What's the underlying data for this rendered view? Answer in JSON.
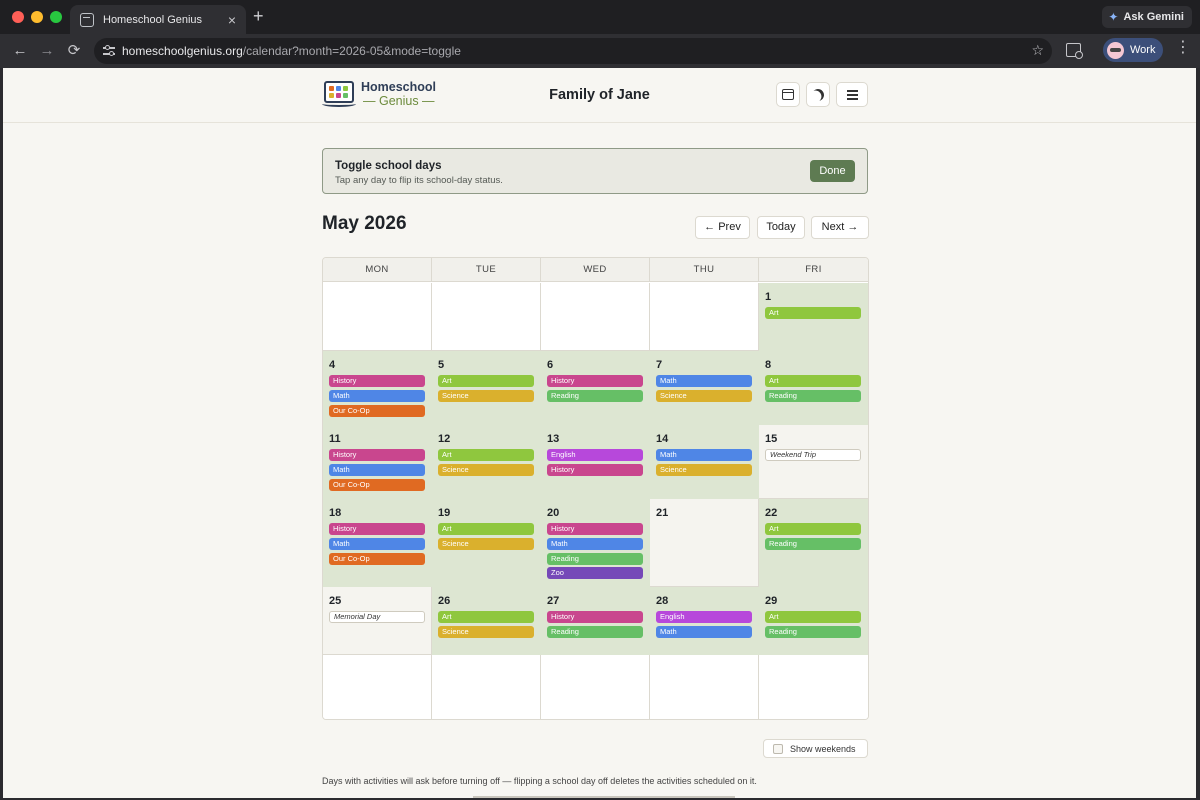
{
  "browser": {
    "tab_title": "Homeschool Genius",
    "tab_close": "×",
    "new_tab": "+",
    "gemini_label": "Ask Gemini",
    "url_host": "homeschoolgenius.org",
    "url_path": "/calendar?month=2026-05&mode=toggle",
    "profile_label": "Work",
    "back": "←",
    "forward": "→",
    "reload": "⟳",
    "star": "☆",
    "kebab": "⋮",
    "gemini_icon": "✦"
  },
  "header": {
    "logo_line1": "Homeschool",
    "logo_line2": "— Genius —",
    "family_title": "Family of Jane"
  },
  "banner": {
    "title": "Toggle school days",
    "subtitle": "Tap any day to flip its school-day status.",
    "done_label": "Done"
  },
  "calendar": {
    "month_title": "May 2026",
    "prev_label": "← Prev",
    "today_label": "Today",
    "next_label": "Next →",
    "weekdays": [
      "MON",
      "TUE",
      "WED",
      "THU",
      "FRI"
    ],
    "colors": {
      "History": "#c9468e",
      "Math": "#4f86e6",
      "Art": "#8fc73e",
      "Science": "#dab02d",
      "Reading": "#66bf66",
      "English": "#b748db",
      "Our Co-Op": "#e06a22",
      "Zoo": "#7649b8"
    },
    "weeks": [
      [
        {
          "day": "",
          "status": "blank",
          "events": []
        },
        {
          "day": "",
          "status": "blank",
          "events": []
        },
        {
          "day": "",
          "status": "blank",
          "events": []
        },
        {
          "day": "",
          "status": "blank",
          "events": []
        },
        {
          "day": "1",
          "status": "school",
          "events": [
            "Art"
          ]
        }
      ],
      [
        {
          "day": "4",
          "status": "school",
          "events": [
            "History",
            "Math",
            "Our Co-Op"
          ]
        },
        {
          "day": "5",
          "status": "school",
          "events": [
            "Art",
            "Science"
          ]
        },
        {
          "day": "6",
          "status": "school",
          "events": [
            "History",
            "Reading"
          ]
        },
        {
          "day": "7",
          "status": "school",
          "events": [
            "Math",
            "Science"
          ]
        },
        {
          "day": "8",
          "status": "school",
          "events": [
            "Art",
            "Reading"
          ]
        }
      ],
      [
        {
          "day": "11",
          "status": "school",
          "events": [
            "History",
            "Math",
            "Our Co-Op"
          ]
        },
        {
          "day": "12",
          "status": "school",
          "events": [
            "Art",
            "Science"
          ]
        },
        {
          "day": "13",
          "status": "school",
          "events": [
            "English",
            "History"
          ]
        },
        {
          "day": "14",
          "status": "school",
          "events": [
            "Math",
            "Science"
          ]
        },
        {
          "day": "15",
          "status": "off",
          "holiday": "Weekend Trip",
          "events": []
        }
      ],
      [
        {
          "day": "18",
          "status": "school",
          "events": [
            "History",
            "Math",
            "Our Co-Op"
          ]
        },
        {
          "day": "19",
          "status": "school",
          "events": [
            "Art",
            "Science"
          ]
        },
        {
          "day": "20",
          "status": "school",
          "events": [
            "History",
            "Math",
            "Reading",
            "Zoo"
          ]
        },
        {
          "day": "21",
          "status": "off",
          "events": []
        },
        {
          "day": "22",
          "status": "school",
          "events": [
            "Art",
            "Reading"
          ]
        }
      ],
      [
        {
          "day": "25",
          "status": "off",
          "holiday": "Memorial Day",
          "events": []
        },
        {
          "day": "26",
          "status": "school",
          "events": [
            "Art",
            "Science"
          ]
        },
        {
          "day": "27",
          "status": "school",
          "events": [
            "History",
            "Reading"
          ]
        },
        {
          "day": "28",
          "status": "school",
          "events": [
            "English",
            "Math"
          ]
        },
        {
          "day": "29",
          "status": "school",
          "events": [
            "Art",
            "Reading"
          ]
        }
      ],
      [
        {
          "day": "",
          "status": "blank",
          "events": []
        },
        {
          "day": "",
          "status": "blank",
          "events": []
        },
        {
          "day": "",
          "status": "blank",
          "events": []
        },
        {
          "day": "",
          "status": "blank",
          "events": []
        },
        {
          "day": "",
          "status": "blank",
          "events": []
        }
      ]
    ]
  },
  "footer": {
    "show_weekends_label": "Show weekends",
    "note": "Days with activities will ask before turning off — flipping a school day off deletes the activities scheduled on it."
  }
}
